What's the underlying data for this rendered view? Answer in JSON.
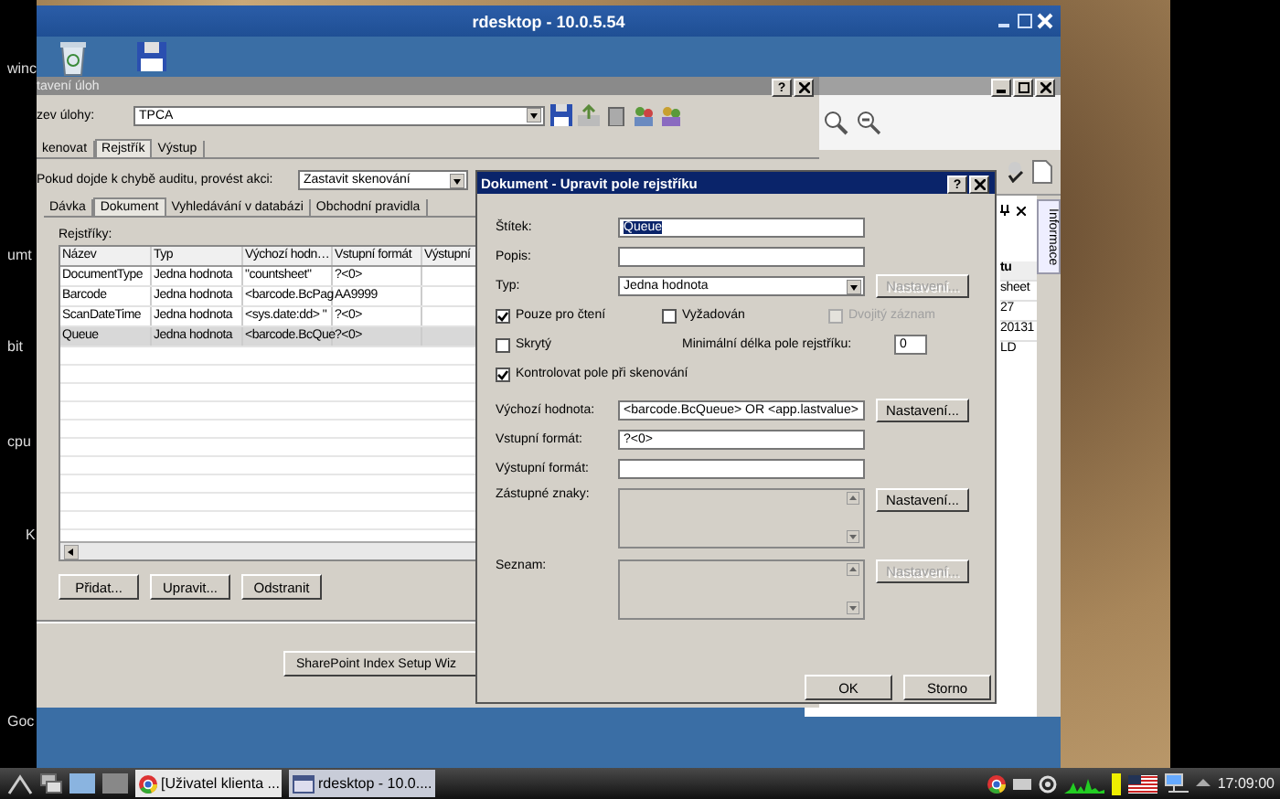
{
  "desktop": {
    "side_labels": [
      "winc",
      "umt",
      "bit",
      "cpu",
      "K",
      "Goc"
    ]
  },
  "rdesktop": {
    "title": "rdesktop - 10.0.5.54"
  },
  "main_window": {
    "title": "tavení úloh",
    "help_glyph": "?",
    "task_label": "zev úlohy:",
    "task_value": "TPCA",
    "tabs": [
      {
        "label": "kenovat",
        "selected": false
      },
      {
        "label": "Rejstřík",
        "selected": true
      },
      {
        "label": "Výstup",
        "selected": false
      }
    ],
    "audit_label": "Pokud dojde k chybě auditu, provést akci:",
    "audit_value": "Zastavit skenování",
    "subtabs": [
      {
        "label": "Dávka",
        "selected": false
      },
      {
        "label": "Dokument",
        "selected": true
      },
      {
        "label": "Vyhledávání v databázi",
        "selected": false
      },
      {
        "label": "Obchodní pravidla",
        "selected": false
      }
    ],
    "table": {
      "title": "Rejstříky:",
      "columns": [
        "Název",
        "Typ",
        "Výchozí hodn…",
        "Vstupní formát",
        "Výstupní"
      ],
      "rows": [
        {
          "cells": [
            "DocumentType",
            "Jedna hodnota",
            "\"countsheet\"",
            "?<0>"
          ],
          "selected": false
        },
        {
          "cells": [
            "Barcode",
            "Jedna hodnota",
            "<barcode.BcPag",
            "AA9999"
          ],
          "selected": false
        },
        {
          "cells": [
            "ScanDateTime",
            "Jedna hodnota",
            "<sys.date:dd> \"",
            "?<0>"
          ],
          "selected": false
        },
        {
          "cells": [
            "Queue",
            "Jedna hodnota",
            "<barcode.BcQue",
            "?<0>"
          ],
          "selected": true
        }
      ]
    },
    "buttons": [
      "Přidat...",
      "Upravit...",
      "Odstranit"
    ],
    "wizard_button": "SharePoint Index Setup Wiz"
  },
  "back_window": {
    "side_tab": "Informace",
    "column": "tu",
    "cells": [
      "sheet",
      "27",
      "20131",
      "LD"
    ]
  },
  "dialog": {
    "title": "Dokument - Upravit pole rejstříku",
    "help_glyph": "?",
    "rows": [
      {
        "kind": "field",
        "label": "Štítek:",
        "value": "Queue",
        "value_selected": true
      },
      {
        "kind": "field",
        "label": "Popis:"
      },
      {
        "kind": "combo",
        "label": "Typ:",
        "value": "Jedna hodnota",
        "button": {
          "label": "Nastavení...",
          "disabled": true
        }
      },
      {
        "kind": "checks",
        "items": [
          {
            "label": "Pouze pro čtení",
            "checked": true,
            "disabled": false
          },
          {
            "label": "Vyžadován",
            "checked": false,
            "disabled": false
          },
          {
            "label": "Dvojitý záznam",
            "checked": false,
            "disabled": true
          }
        ]
      },
      {
        "kind": "checks",
        "items": [
          {
            "label": "Skrytý",
            "checked": false,
            "disabled": false
          }
        ],
        "min_length": {
          "label": "Minimální délka pole rejstříku:",
          "value": "0"
        }
      },
      {
        "kind": "checks",
        "items": [
          {
            "label": "Kontrolovat pole při skenování",
            "checked": true,
            "disabled": false
          }
        ]
      },
      {
        "kind": "field",
        "label": "Výchozí hodnota:",
        "value": "<barcode.BcQueue> OR <app.lastvalue>",
        "button": {
          "label": "Nastavení...",
          "disabled": false
        }
      },
      {
        "kind": "field",
        "label": "Vstupní formát:",
        "value": "?<0>"
      },
      {
        "kind": "field",
        "label": "Výstupní formát:"
      },
      {
        "kind": "list",
        "label": "Zástupné znaky:",
        "button": {
          "label": "Nastavení...",
          "disabled": false
        }
      },
      {
        "kind": "list",
        "label": "Seznam:",
        "button": {
          "label": "Nastavení...",
          "disabled": true
        }
      }
    ],
    "buttons": [
      "OK",
      "Storno"
    ]
  },
  "taskbar": {
    "tasks": [
      {
        "label": "[Uživatel klienta ...",
        "selected": false
      },
      {
        "label": "rdesktop - 10.0....",
        "selected": true
      }
    ],
    "clock": "17:09:00"
  }
}
